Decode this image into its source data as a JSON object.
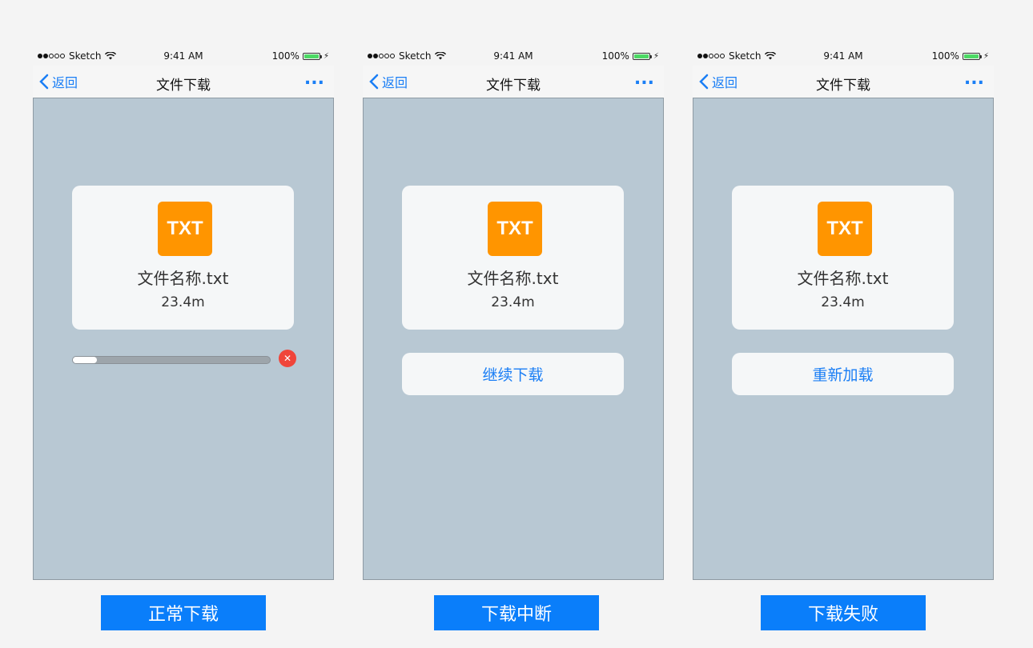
{
  "colors": {
    "accent": "#1a7ef5",
    "file_icon": "#ff9500",
    "cancel": "#f0453a",
    "caption_bg": "#0a7efa",
    "content_bg": "#b8c8d3"
  },
  "status_bar": {
    "carrier": "Sketch",
    "time": "9:41 AM",
    "battery": "100%",
    "signal_icon": "signal-dots-icon",
    "wifi_icon": "wifi-icon",
    "charge_icon": "bolt-icon"
  },
  "nav": {
    "back_label": "返回",
    "title": "文件下载",
    "more_label": "..."
  },
  "file": {
    "icon_label": "TXT",
    "name": "文件名称.txt",
    "size": "23.4m"
  },
  "screens": [
    {
      "caption": "正常下载",
      "progress": 0.12
    },
    {
      "caption": "下载中断",
      "action_label": "继续下载"
    },
    {
      "caption": "下载失败",
      "action_label": "重新加载"
    }
  ]
}
